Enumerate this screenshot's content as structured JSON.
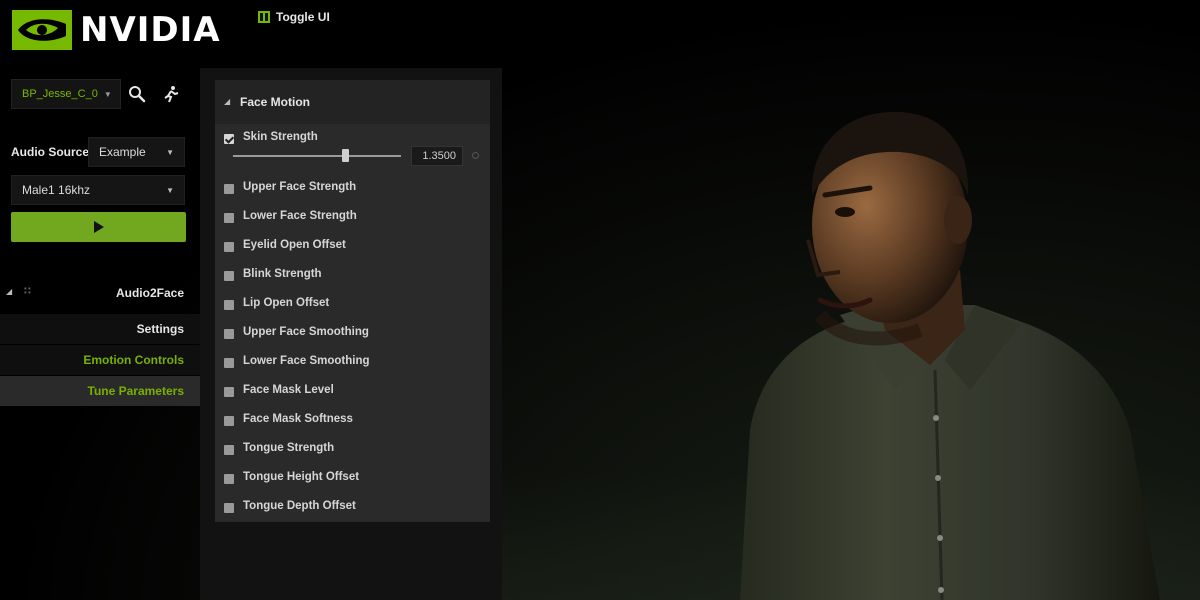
{
  "brand": {
    "wordmark": "NVIDIA",
    "accent": "#76b900"
  },
  "top_bar": {
    "toggle_ui_label": "Toggle UI",
    "toggle_icon": "toggle-ui-icon"
  },
  "left_panel": {
    "character_select": "BP_Jesse_C_0",
    "audio_source_label": "Audio Source",
    "audio_source_value": "Example",
    "audio_clip_value": "Male1 16khz",
    "icons": [
      "search-icon",
      "running-figure-icon",
      "play-icon"
    ],
    "section": {
      "title": "Audio2Face",
      "items": [
        {
          "label": "Settings",
          "active": false
        },
        {
          "label": "Emotion Controls",
          "active": false
        },
        {
          "label": "Tune Parameters",
          "active": true
        }
      ]
    }
  },
  "face_motion": {
    "title": "Face Motion",
    "skin_strength": {
      "label": "Skin Strength",
      "checked": true,
      "value_text": "1.3500",
      "value": 1.35,
      "slider_fraction": 0.67
    },
    "params": [
      {
        "label": "Upper Face Strength",
        "checked": false
      },
      {
        "label": "Lower Face Strength",
        "checked": false
      },
      {
        "label": "Eyelid Open Offset",
        "checked": false
      },
      {
        "label": "Blink Strength",
        "checked": false
      },
      {
        "label": "Lip Open Offset",
        "checked": false
      },
      {
        "label": "Upper Face Smoothing",
        "checked": false
      },
      {
        "label": "Lower Face Smoothing",
        "checked": false
      },
      {
        "label": "Face Mask Level",
        "checked": false
      },
      {
        "label": "Face Mask Softness",
        "checked": false
      },
      {
        "label": "Tongue Strength",
        "checked": false
      },
      {
        "label": "Tongue Height Offset",
        "checked": false
      },
      {
        "label": "Tongue Depth Offset",
        "checked": false
      }
    ]
  }
}
